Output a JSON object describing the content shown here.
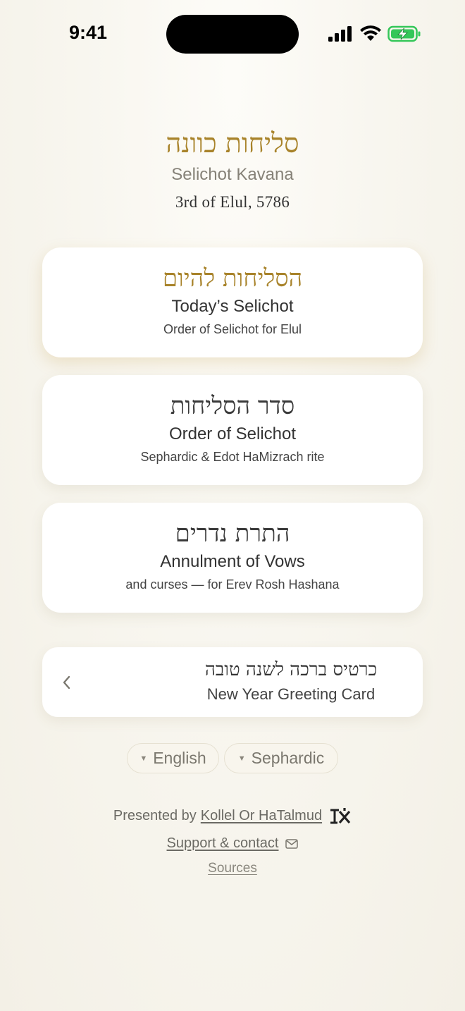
{
  "status_bar": {
    "time": "9:41"
  },
  "header": {
    "title_he": "סליחות כוונה",
    "title_en": "Selichot Kavana",
    "date": "3rd of Elul, 5786"
  },
  "cards": [
    {
      "he": "הסליחות להיום",
      "en": "Today’s Selichot",
      "sub": "Order of Selichot for Elul"
    },
    {
      "he": "סדר הסליחות",
      "en": "Order of Selichot",
      "sub": "Sephardic & Edot HaMizrach rite"
    },
    {
      "he": "התרת נדרים",
      "en": "Annulment of Vows",
      "sub": "and curses — for Erev Rosh Hashana"
    }
  ],
  "greeting_card": {
    "he": "כרטיס ברכה לשנה טובה",
    "en": "New Year Greeting Card"
  },
  "selectors": {
    "language": "English",
    "rite": "Sephardic"
  },
  "footer": {
    "presented_by": "Presented by",
    "org_name": "Kollel Or HaTalmud",
    "logo_text": "אוה",
    "support": "Support & contact",
    "sources": "Sources"
  },
  "colors": {
    "accent_gold": "#a8832a",
    "battery_green": "#34c759"
  }
}
